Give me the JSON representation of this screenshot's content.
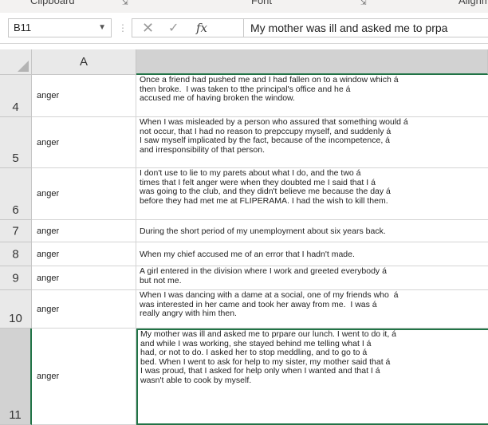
{
  "ribbon": {
    "groups": [
      "Clipboard",
      "Font",
      "Alignment"
    ],
    "launcher_icon": "dialog-launcher-icon"
  },
  "formula_bar": {
    "name_box": "B11",
    "formula_text": "My mother was ill and asked me to prpare our lunch. I went to do it, á",
    "formula_visible": "My mother was ill and asked me to prpa",
    "cancel_icon": "✕",
    "enter_icon": "✓",
    "fx_label": "fx"
  },
  "columns": [
    "A",
    ""
  ],
  "rows": [
    {
      "num": "4",
      "a": "anger",
      "b": "Once a friend had pushed me and I had fallen on to a window which á\nthen broke.  I was taken to tthe principal's office and he á\naccused me of having broken the window."
    },
    {
      "num": "5",
      "a": "anger",
      "b": "When I was misleaded by a person who assured that something would á\nnot occur, that I had no reason to prepccupy myself, and suddenly á\nI saw myself implicated by the fact, because of the incompetence, á\nand irresponsibility of that person."
    },
    {
      "num": "6",
      "a": "anger",
      "b": "I don't use to lie to my parets about what I do, and the two á\ntimes that I felt anger were when they doubted me I said that I á\nwas going to the club, and they didn't believe me because the day á\nbefore they had met me at FLIPERAMA. I had the wish to kill them."
    },
    {
      "num": "7",
      "a": "anger",
      "b": "During the short period of my unemployment about six years back."
    },
    {
      "num": "8",
      "a": "anger",
      "b": "When my chief accused me of an error that I hadn't made."
    },
    {
      "num": "9",
      "a": "anger",
      "b": "A girl entered in the division where I work and greeted everybody á\nbut not me."
    },
    {
      "num": "10",
      "a": "anger",
      "b": "When I was dancing with a dame at a social, one of my friends who  á\nwas interested in her came and took her away from me.  I was á\nreally angry with him then."
    },
    {
      "num": "11",
      "a": "anger",
      "b": "My mother was ill and asked me to prpare our lunch. I went to do it, á\nand while I was working, she stayed behind me telling what I á\nhad, or not to do. I asked her to stop meddling, and to go to á\nbed. When I went to ask for help to my sister, my mother said that á\nI was proud, that I asked for help only when I wanted and that I á\nwasn't able to cook by myself."
    }
  ],
  "colors": {
    "selection_green": "#217346",
    "header_bg": "#e9e9e9",
    "header_selected_bg": "#d2d2d2"
  }
}
